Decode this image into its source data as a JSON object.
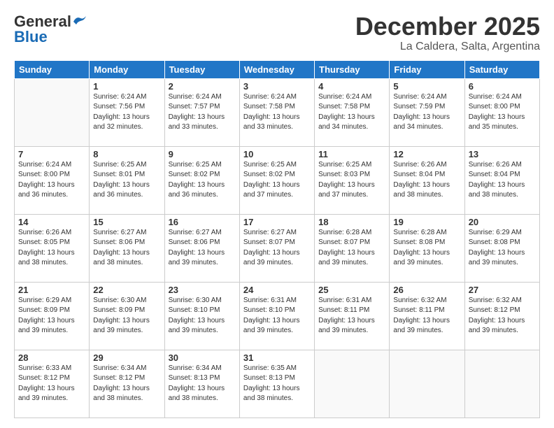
{
  "header": {
    "logo_general": "General",
    "logo_blue": "Blue",
    "month": "December 2025",
    "location": "La Caldera, Salta, Argentina"
  },
  "weekdays": [
    "Sunday",
    "Monday",
    "Tuesday",
    "Wednesday",
    "Thursday",
    "Friday",
    "Saturday"
  ],
  "weeks": [
    [
      {
        "day": "",
        "info": ""
      },
      {
        "day": "1",
        "info": "Sunrise: 6:24 AM\nSunset: 7:56 PM\nDaylight: 13 hours\nand 32 minutes."
      },
      {
        "day": "2",
        "info": "Sunrise: 6:24 AM\nSunset: 7:57 PM\nDaylight: 13 hours\nand 33 minutes."
      },
      {
        "day": "3",
        "info": "Sunrise: 6:24 AM\nSunset: 7:58 PM\nDaylight: 13 hours\nand 33 minutes."
      },
      {
        "day": "4",
        "info": "Sunrise: 6:24 AM\nSunset: 7:58 PM\nDaylight: 13 hours\nand 34 minutes."
      },
      {
        "day": "5",
        "info": "Sunrise: 6:24 AM\nSunset: 7:59 PM\nDaylight: 13 hours\nand 34 minutes."
      },
      {
        "day": "6",
        "info": "Sunrise: 6:24 AM\nSunset: 8:00 PM\nDaylight: 13 hours\nand 35 minutes."
      }
    ],
    [
      {
        "day": "7",
        "info": "Sunrise: 6:24 AM\nSunset: 8:00 PM\nDaylight: 13 hours\nand 36 minutes."
      },
      {
        "day": "8",
        "info": "Sunrise: 6:25 AM\nSunset: 8:01 PM\nDaylight: 13 hours\nand 36 minutes."
      },
      {
        "day": "9",
        "info": "Sunrise: 6:25 AM\nSunset: 8:02 PM\nDaylight: 13 hours\nand 36 minutes."
      },
      {
        "day": "10",
        "info": "Sunrise: 6:25 AM\nSunset: 8:02 PM\nDaylight: 13 hours\nand 37 minutes."
      },
      {
        "day": "11",
        "info": "Sunrise: 6:25 AM\nSunset: 8:03 PM\nDaylight: 13 hours\nand 37 minutes."
      },
      {
        "day": "12",
        "info": "Sunrise: 6:26 AM\nSunset: 8:04 PM\nDaylight: 13 hours\nand 38 minutes."
      },
      {
        "day": "13",
        "info": "Sunrise: 6:26 AM\nSunset: 8:04 PM\nDaylight: 13 hours\nand 38 minutes."
      }
    ],
    [
      {
        "day": "14",
        "info": "Sunrise: 6:26 AM\nSunset: 8:05 PM\nDaylight: 13 hours\nand 38 minutes."
      },
      {
        "day": "15",
        "info": "Sunrise: 6:27 AM\nSunset: 8:06 PM\nDaylight: 13 hours\nand 38 minutes."
      },
      {
        "day": "16",
        "info": "Sunrise: 6:27 AM\nSunset: 8:06 PM\nDaylight: 13 hours\nand 39 minutes."
      },
      {
        "day": "17",
        "info": "Sunrise: 6:27 AM\nSunset: 8:07 PM\nDaylight: 13 hours\nand 39 minutes."
      },
      {
        "day": "18",
        "info": "Sunrise: 6:28 AM\nSunset: 8:07 PM\nDaylight: 13 hours\nand 39 minutes."
      },
      {
        "day": "19",
        "info": "Sunrise: 6:28 AM\nSunset: 8:08 PM\nDaylight: 13 hours\nand 39 minutes."
      },
      {
        "day": "20",
        "info": "Sunrise: 6:29 AM\nSunset: 8:08 PM\nDaylight: 13 hours\nand 39 minutes."
      }
    ],
    [
      {
        "day": "21",
        "info": "Sunrise: 6:29 AM\nSunset: 8:09 PM\nDaylight: 13 hours\nand 39 minutes."
      },
      {
        "day": "22",
        "info": "Sunrise: 6:30 AM\nSunset: 8:09 PM\nDaylight: 13 hours\nand 39 minutes."
      },
      {
        "day": "23",
        "info": "Sunrise: 6:30 AM\nSunset: 8:10 PM\nDaylight: 13 hours\nand 39 minutes."
      },
      {
        "day": "24",
        "info": "Sunrise: 6:31 AM\nSunset: 8:10 PM\nDaylight: 13 hours\nand 39 minutes."
      },
      {
        "day": "25",
        "info": "Sunrise: 6:31 AM\nSunset: 8:11 PM\nDaylight: 13 hours\nand 39 minutes."
      },
      {
        "day": "26",
        "info": "Sunrise: 6:32 AM\nSunset: 8:11 PM\nDaylight: 13 hours\nand 39 minutes."
      },
      {
        "day": "27",
        "info": "Sunrise: 6:32 AM\nSunset: 8:12 PM\nDaylight: 13 hours\nand 39 minutes."
      }
    ],
    [
      {
        "day": "28",
        "info": "Sunrise: 6:33 AM\nSunset: 8:12 PM\nDaylight: 13 hours\nand 39 minutes."
      },
      {
        "day": "29",
        "info": "Sunrise: 6:34 AM\nSunset: 8:12 PM\nDaylight: 13 hours\nand 38 minutes."
      },
      {
        "day": "30",
        "info": "Sunrise: 6:34 AM\nSunset: 8:13 PM\nDaylight: 13 hours\nand 38 minutes."
      },
      {
        "day": "31",
        "info": "Sunrise: 6:35 AM\nSunset: 8:13 PM\nDaylight: 13 hours\nand 38 minutes."
      },
      {
        "day": "",
        "info": ""
      },
      {
        "day": "",
        "info": ""
      },
      {
        "day": "",
        "info": ""
      }
    ]
  ]
}
